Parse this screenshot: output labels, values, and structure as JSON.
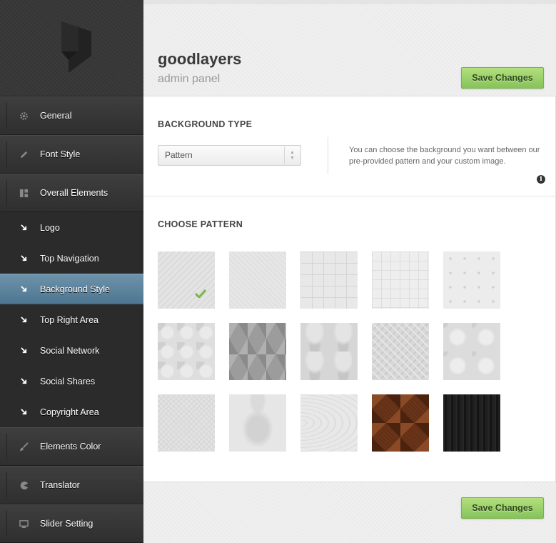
{
  "sidebar": {
    "items": [
      {
        "label": "General",
        "icon": "gear-icon"
      },
      {
        "label": "Font Style",
        "icon": "pencil-icon"
      },
      {
        "label": "Overall Elements",
        "icon": "layout-icon"
      },
      {
        "label": "Logo",
        "icon": "arrow-down-right-icon"
      },
      {
        "label": "Top Navigation",
        "icon": "arrow-down-right-icon"
      },
      {
        "label": "Background Style",
        "icon": "arrow-down-right-icon"
      },
      {
        "label": "Top Right Area",
        "icon": "arrow-down-right-icon"
      },
      {
        "label": "Social Network",
        "icon": "arrow-down-right-icon"
      },
      {
        "label": "Social Shares",
        "icon": "arrow-down-right-icon"
      },
      {
        "label": "Copyright Area",
        "icon": "arrow-down-right-icon"
      },
      {
        "label": "Elements Color",
        "icon": "brush-icon"
      },
      {
        "label": "Translator",
        "icon": "pacman-icon"
      },
      {
        "label": "Slider Setting",
        "icon": "monitor-icon"
      }
    ],
    "active": "Background Style"
  },
  "header": {
    "title": "goodlayers",
    "subtitle": "admin panel",
    "save_label": "Save Changes"
  },
  "background_type": {
    "title": "BACKGROUND TYPE",
    "selected": "Pattern",
    "help": "You can choose the background you want between our pre-provided pattern and your custom image."
  },
  "choose_pattern": {
    "title": "CHOOSE PATTERN",
    "selected_index": 0,
    "patterns": [
      "pattern-1",
      "pattern-2",
      "pattern-3",
      "pattern-4",
      "pattern-5",
      "pattern-6",
      "pattern-7",
      "pattern-8",
      "pattern-9",
      "pattern-10",
      "pattern-11",
      "pattern-12",
      "pattern-13",
      "pattern-14",
      "pattern-15"
    ]
  },
  "footer": {
    "save_label": "Save Changes"
  },
  "colors": {
    "accent_green": "#8fcb60",
    "active_blue": "#5e86a0",
    "sidebar_dark": "#2e2e2e"
  }
}
